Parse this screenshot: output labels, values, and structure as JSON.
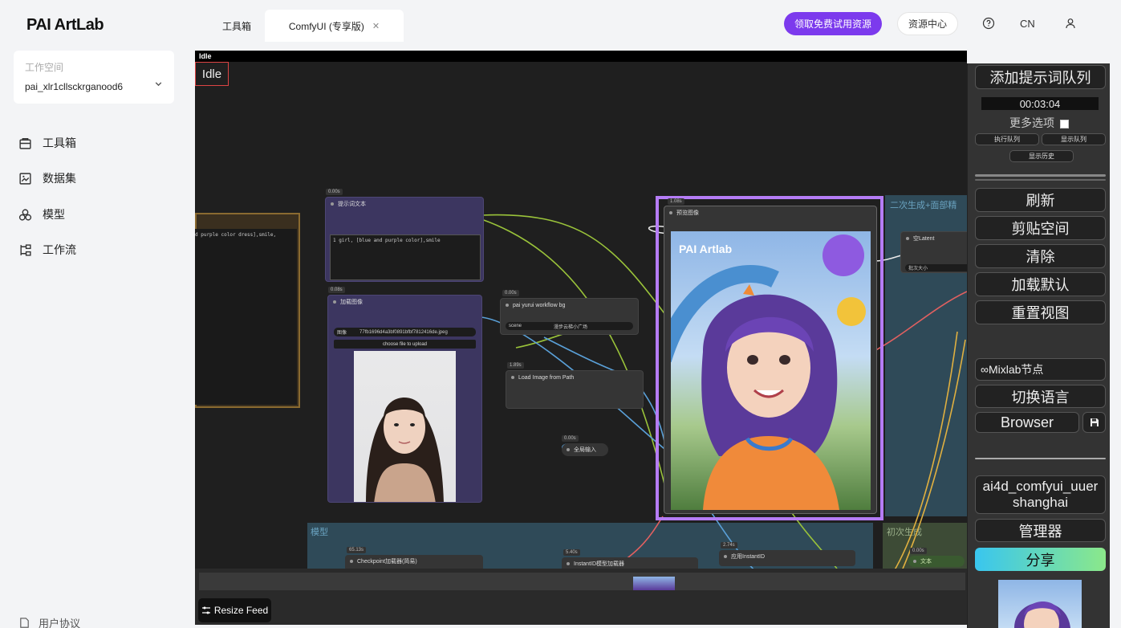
{
  "sidebar": {
    "logo": "PAI ArtLab",
    "workspace_label": "工作空间",
    "workspace_value": "pai_xlr1cllsckrganood6",
    "nav": [
      {
        "label": "工具箱",
        "icon": "toolbox-icon"
      },
      {
        "label": "数据集",
        "icon": "dataset-icon"
      },
      {
        "label": "模型",
        "icon": "model-icon"
      },
      {
        "label": "工作流",
        "icon": "workflow-icon"
      }
    ],
    "footer": "用户协议"
  },
  "topbar": {
    "tabs": [
      {
        "label": "工具箱"
      },
      {
        "label": "ComfyUI (专享版)"
      }
    ],
    "promo_button": "领取免费试用资源",
    "resource_button": "资源中心",
    "language": "CN"
  },
  "canvas": {
    "status_strip": "Idle",
    "status_box": "Idle",
    "nodes": {
      "prompt": {
        "badge": "0.00s",
        "title": "提示词文本",
        "text": "1 girl, [blue and purple color],smile"
      },
      "left_text": "d purple color dress],smile,",
      "load_image": {
        "badge": "0.08s",
        "title": "加载图像",
        "image_label": "图像",
        "image_file": "77fb1696d4a3bf0891bfbf7812416de.jpeg",
        "upload_button": "choose file to upload"
      },
      "workflow_bg": {
        "badge": "0.00s",
        "title": "pai yurui workflow bg",
        "scene_label": "scene",
        "scene_value": "漫步云梯小广场"
      },
      "load_path": {
        "badge": "1.89s",
        "title": "Load Image from Path"
      },
      "global_input": {
        "badge": "0.00s",
        "title": "全局输入"
      },
      "preview": {
        "badge": "1.08s",
        "title": "预览图像",
        "image_caption": "PAI Artlab"
      },
      "latent": {
        "title": "空Latent",
        "field": "批次大小"
      },
      "checkpoint": {
        "badge": "65.13s",
        "title": "Checkpoint加载器(简易)"
      },
      "instantid_loader": {
        "badge": "5.40s",
        "title": "InstantID模型加载器"
      },
      "apply_instantid": {
        "badge": "2.74s",
        "title": "应用InstantID"
      },
      "text_node": {
        "badge": "0.00s",
        "title": "文本"
      }
    },
    "groups": {
      "model": "模型",
      "initial": "初次生成",
      "secondary": "二次生成+面部精"
    }
  },
  "right_panel": {
    "queue_button": "添加提示词队列",
    "timer": "00:03:04",
    "more_options": "更多选项",
    "exec_queue": "执行队列",
    "show_queue": "显示队列",
    "show_history": "显示历史",
    "refresh": "刷新",
    "clipspace": "剪贴空间",
    "clear": "清除",
    "load_default": "加载默认",
    "reset_view": "重置视图",
    "mixlab": "∞Mixlab节点",
    "switch_language": "切换语言",
    "browser": "Browser",
    "user_line1": "ai4d_comfyui_uuer",
    "user_line2": "shanghai",
    "manager": "管理器",
    "share": "分享"
  },
  "resize_feed": "Resize Feed",
  "colors": {
    "accent_purple": "#7c3aed",
    "canvas_bg": "#1f1f1f",
    "panel_bg": "#333333",
    "preview_border": "#b57cf6"
  }
}
